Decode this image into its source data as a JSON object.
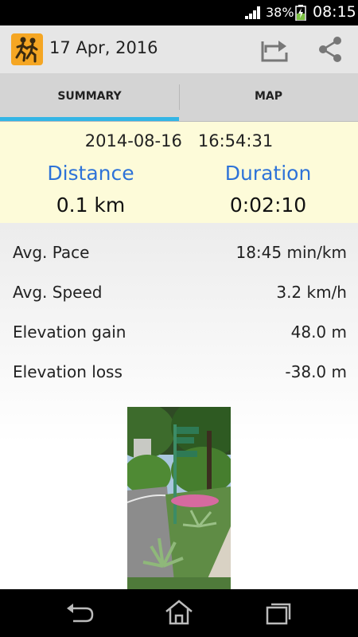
{
  "status_bar": {
    "battery_percent": "38%",
    "time": "08:15"
  },
  "action_bar": {
    "title": "17 Apr, 2016",
    "app_icon": "running-people-icon",
    "export_icon": "export-icon",
    "share_icon": "share-icon"
  },
  "tabs": [
    {
      "label": "SUMMARY",
      "selected": true
    },
    {
      "label": "MAP",
      "selected": false
    }
  ],
  "summary": {
    "date": "2014-08-16",
    "time": "16:54:31",
    "distance_label": "Distance",
    "distance_value": "0.1 km",
    "duration_label": "Duration",
    "duration_value": "0:02:10"
  },
  "stats": [
    {
      "label": "Avg. Pace",
      "value": "18:45 min/km"
    },
    {
      "label": "Avg. Speed",
      "value": "3.2 km/h"
    },
    {
      "label": "Elevation gain",
      "value": "48.0 m"
    },
    {
      "label": "Elevation loss",
      "value": "-38.0 m"
    }
  ],
  "colors": {
    "accent_blue": "#2e73d8",
    "tab_indicator": "#33b5e5",
    "summary_bg": "#fdfbd9",
    "app_icon_bg": "#f5a623"
  },
  "nav_bar": {
    "back_icon": "back-icon",
    "home_icon": "home-icon",
    "recents_icon": "recent-apps-icon"
  }
}
